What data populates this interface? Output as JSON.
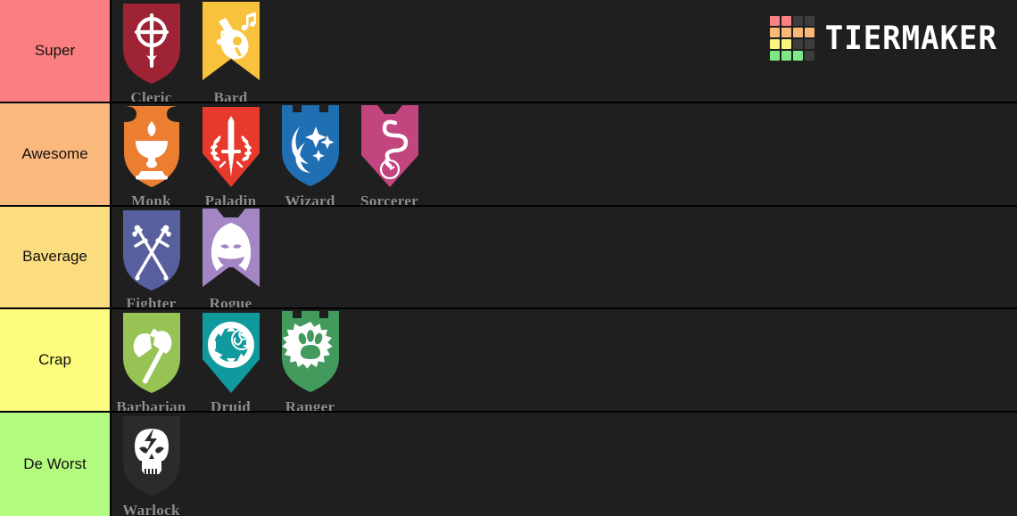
{
  "app": {
    "logo_text": "TIERMAKER",
    "background": "#1b1b1b"
  },
  "logo": {
    "grid_colors": [
      "#f98181",
      "#f98181",
      "#3d3d3d",
      "#3d3d3d",
      "#fbb977",
      "#fbb977",
      "#fbb977",
      "#fbb977",
      "#f9f47e",
      "#f9f47e",
      "#3d3d3d",
      "#3d3d3d",
      "#7ee887",
      "#7ee887",
      "#7ee887",
      "#3d3d3d"
    ]
  },
  "tiers": [
    {
      "label": "Super",
      "color": "#fb7f80",
      "items": [
        {
          "name": "Cleric",
          "color": "#9d2335",
          "shape": "rounded-shield",
          "icon": "celtic-cross-icon"
        },
        {
          "name": "Bard",
          "color": "#f9c23c",
          "shape": "banner",
          "icon": "lute-icon"
        }
      ]
    },
    {
      "label": "Awesome",
      "color": "#fbb97e",
      "items": [
        {
          "name": "Monk",
          "color": "#ec7e32",
          "shape": "notched-shield",
          "icon": "oil-lamp-icon"
        },
        {
          "name": "Paladin",
          "color": "#e8392d",
          "shape": "pointed-shield",
          "icon": "sword-laurel-icon"
        },
        {
          "name": "Wizard",
          "color": "#1f6fb2",
          "shape": "castle-shield",
          "icon": "swirl-stars-icon"
        },
        {
          "name": "Sorcerer",
          "color": "#c2457f",
          "shape": "notch-point",
          "icon": "smoke-swirl-icon"
        }
      ]
    },
    {
      "label": "Baverage",
      "color": "#fbdc7e",
      "items": [
        {
          "name": "Fighter",
          "color": "#585f9e",
          "shape": "rounded-shield",
          "icon": "crossed-swords-icon"
        },
        {
          "name": "Rogue",
          "color": "#a486c4",
          "shape": "banner-notched",
          "icon": "hooded-figure-icon"
        }
      ]
    },
    {
      "label": "Crap",
      "color": "#fbfb7e",
      "items": [
        {
          "name": "Barbarian",
          "color": "#97c355",
          "shape": "rounded-shield",
          "icon": "battle-axe-icon"
        },
        {
          "name": "Druid",
          "color": "#119a9d",
          "shape": "pointed-shield",
          "icon": "celtic-circle-icon"
        },
        {
          "name": "Ranger",
          "color": "#429b5d",
          "shape": "castle-shield",
          "icon": "paw-print-icon"
        }
      ]
    },
    {
      "label": "De Worst",
      "color": "#b2fb7e",
      "items": [
        {
          "name": "Warlock",
          "color": "#2b2b2b",
          "shape": "rounded-shield",
          "icon": "skull-lightning-icon"
        }
      ]
    }
  ]
}
